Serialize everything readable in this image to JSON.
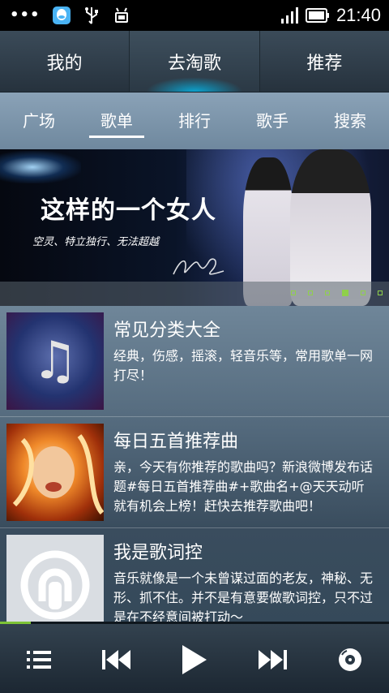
{
  "status_bar": {
    "left_dots": "•••",
    "icons": [
      "qq-icon",
      "usb-icon",
      "android-debug-icon"
    ],
    "right_icons": [
      "signal-icon",
      "battery-icon"
    ],
    "time": "21:40"
  },
  "top_tabs": [
    {
      "label": "我的",
      "active": false
    },
    {
      "label": "去淘歌",
      "active": true
    },
    {
      "label": "推荐",
      "active": false
    }
  ],
  "sub_tabs": [
    {
      "label": "广场",
      "active": false
    },
    {
      "label": "歌单",
      "active": true
    },
    {
      "label": "排行",
      "active": false
    },
    {
      "label": "歌手",
      "active": false
    },
    {
      "label": "搜索",
      "active": false
    }
  ],
  "banner": {
    "title": "这样的一个女人",
    "subtitle": "空灵、特立独行、无法超越",
    "pager": {
      "count": 6,
      "active_index": 4
    }
  },
  "list": [
    {
      "title": "常见分类大全",
      "description": "经典，伤感，摇滚，轻音乐等，常用歌单一网打尽！",
      "icon": "music-note-icon"
    },
    {
      "title": "每日五首推荐曲",
      "description": "亲，今天有你推荐的歌曲吗？新浪微博发布话题#每日五首推荐曲#+歌曲名+@天天动听 就有机会上榜！赶快去推荐歌曲吧！",
      "icon": "singer-photo"
    },
    {
      "title": "我是歌词控",
      "description": "音乐就像是一个未曾谋过面的老友，神秘、无形、抓不住。并不是有意要做歌词控，只不过是在不经意间被打动～",
      "icon": "microphone-logo-icon"
    }
  ],
  "playback": {
    "progress": 0.08
  },
  "player_controls": [
    "playlist-icon",
    "previous-icon",
    "play-icon",
    "next-icon",
    "disc-icon"
  ],
  "colors": {
    "accent_green": "#7dc336",
    "active_glow": "#00c8ff"
  }
}
